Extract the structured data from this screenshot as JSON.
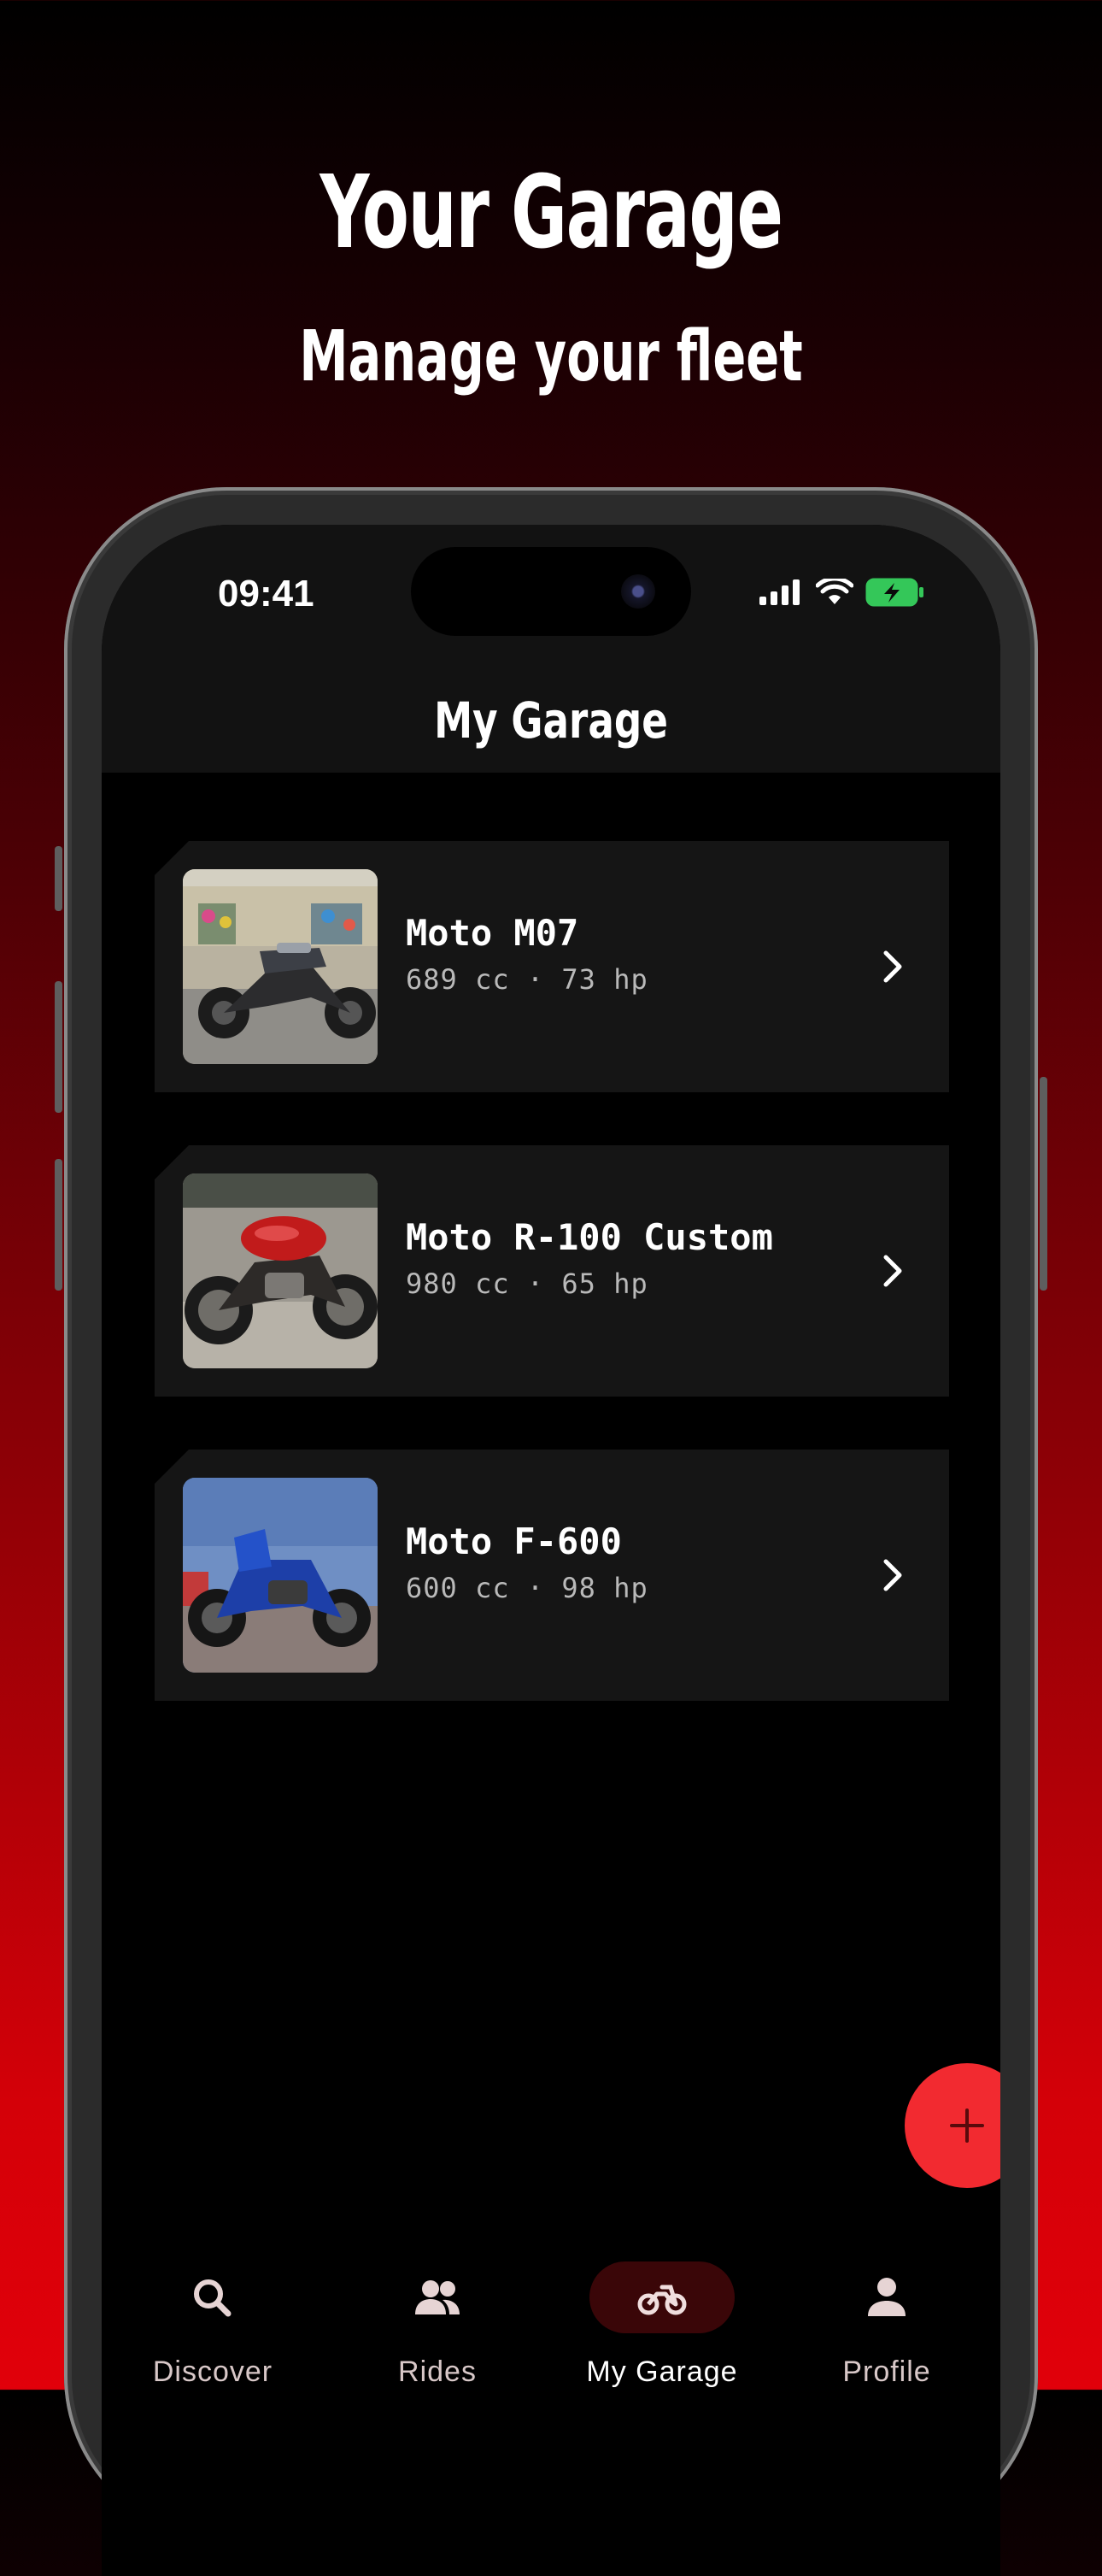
{
  "promo": {
    "title": "Your Garage",
    "subtitle": "Manage your fleet"
  },
  "status_bar": {
    "time": "09:41",
    "icons": [
      "cellular-signal-icon",
      "wifi-icon",
      "battery-charging-icon"
    ]
  },
  "header": {
    "title": "My Garage"
  },
  "bikes": [
    {
      "name": "Moto M07",
      "specs": "689 cc · 73 hp",
      "photo": "grey naked motorcycle photo"
    },
    {
      "name": "Moto R-100 Custom",
      "specs": "980 cc · 65 hp",
      "photo": "red cafe racer motorcycle photo"
    },
    {
      "name": "Moto F-600",
      "specs": "600 cc · 98 hp",
      "photo": "blue sport-touring motorcycle photo"
    }
  ],
  "fab": {
    "icon": "plus-icon",
    "color": "#f22a30"
  },
  "bottom_nav": {
    "items": [
      {
        "label": "Discover",
        "icon": "search-icon",
        "active": false
      },
      {
        "label": "Rides",
        "icon": "group-icon",
        "active": false
      },
      {
        "label": "My Garage",
        "icon": "motorcycle-icon",
        "active": true
      },
      {
        "label": "Profile",
        "icon": "person-icon",
        "active": false
      }
    ]
  },
  "colors": {
    "accent": "#f22a30",
    "card_background": "#151515",
    "header_background": "#121212",
    "active_nav_pill": "#3a0608"
  }
}
